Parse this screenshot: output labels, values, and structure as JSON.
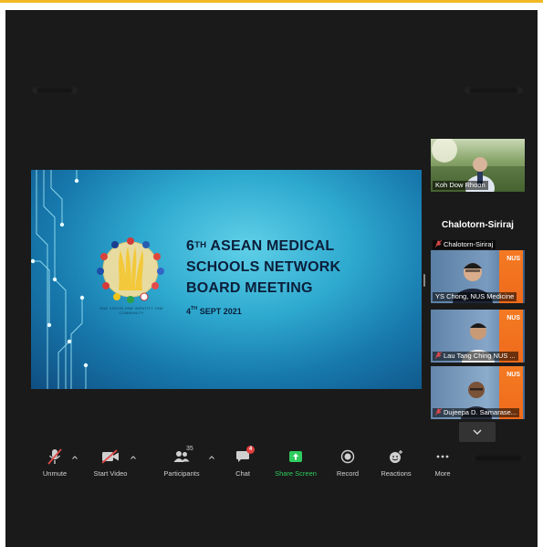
{
  "colors": {
    "accent_bar": "#f2b824",
    "share_green": "#2fcc5d",
    "active_outline": "#d8e84a",
    "chat_badge": "#e03e3e"
  },
  "slide": {
    "title_line1_pre": "6",
    "title_line1_sup": "TH",
    "title_line1_post": " ASEAN MEDICAL",
    "title_line2": "SCHOOLS NETWORK",
    "title_line3": "BOARD MEETING",
    "date_pre": "4",
    "date_sup": "TH",
    "date_post": " SEPT 2021",
    "logo_caption": "ONE VISION ONE IDENTITY ONE COMMUNITY"
  },
  "gallery": {
    "tiles": [
      {
        "name": "Koh Dow Rhoon",
        "muted": false
      },
      {
        "name": "Chalotorn-Siriraj",
        "big_name": "Chalotorn-Siriraj",
        "muted": true
      },
      {
        "name": "YS Chong, NUS Medicine",
        "muted": false,
        "active": true
      },
      {
        "name": "Lau Tang Ching NUS ...",
        "muted": true
      },
      {
        "name": "Dujeepa D. Samarase...",
        "muted": true
      }
    ],
    "scroll_icon": "chevron-down-icon"
  },
  "toolbar": {
    "unmute": "Unmute",
    "start_video": "Start Video",
    "participants": "Participants",
    "participants_count": "35",
    "chat": "Chat",
    "chat_badge": "4",
    "share_screen": "Share Screen",
    "record": "Record",
    "reactions": "Reactions",
    "more": "More"
  }
}
